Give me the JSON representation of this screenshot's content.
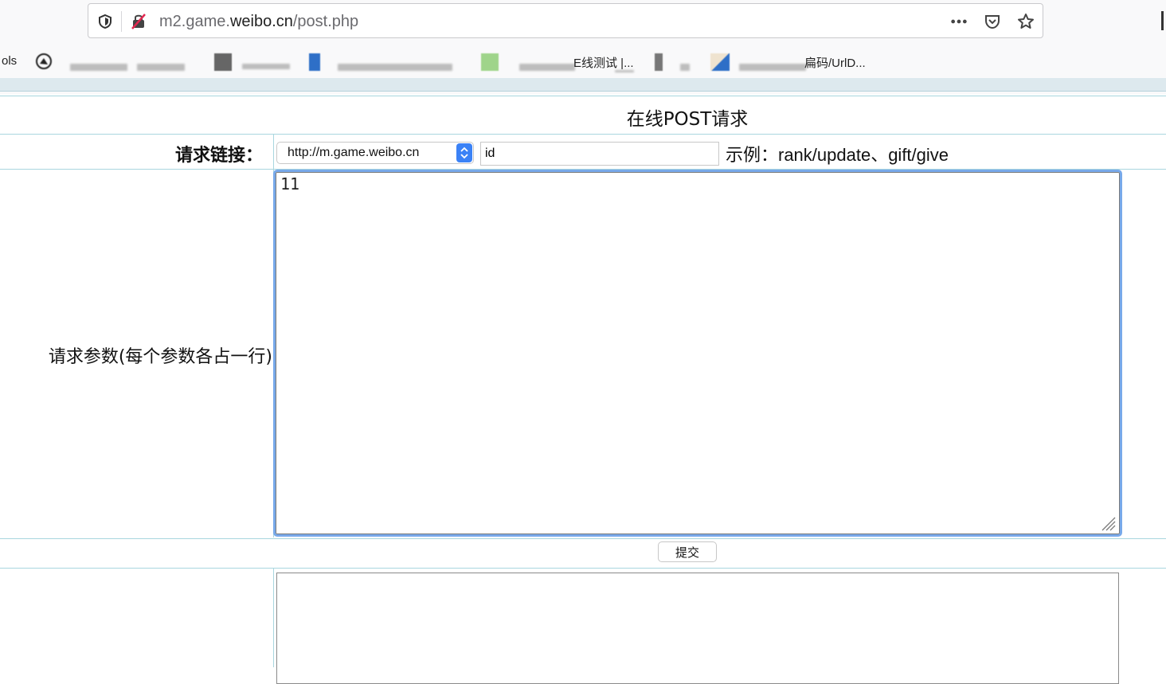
{
  "browser": {
    "url_host_prefix": "m2.game.",
    "url_host_main": "weibo.cn",
    "url_path": "/post.php",
    "bookmarks": [
      {
        "label": "ols"
      },
      {
        "label": "E线测试 |..."
      },
      {
        "label": "扁码/UrlD..."
      }
    ]
  },
  "page": {
    "title": "在线POST请求",
    "link_label": "请求链接：",
    "host_select": {
      "selected": "http://m.game.weibo.cn"
    },
    "path_input": {
      "value": "id"
    },
    "example": "示例：rank/update、gift/give",
    "params_label": "请求参数(每个参数各占一行)",
    "params_value": "11",
    "submit_label": "提交",
    "result_value": ""
  },
  "icons": {
    "shield": "shield-icon",
    "insecure": "insecure-connection-icon",
    "more": "more-actions-icon",
    "pocket": "pocket-icon",
    "bookmark_star": "bookmark-star-icon"
  },
  "colors": {
    "table_border": "#a9d6df",
    "focus_ring": "#78a9ea",
    "select_arrow": "#3b82f6"
  }
}
